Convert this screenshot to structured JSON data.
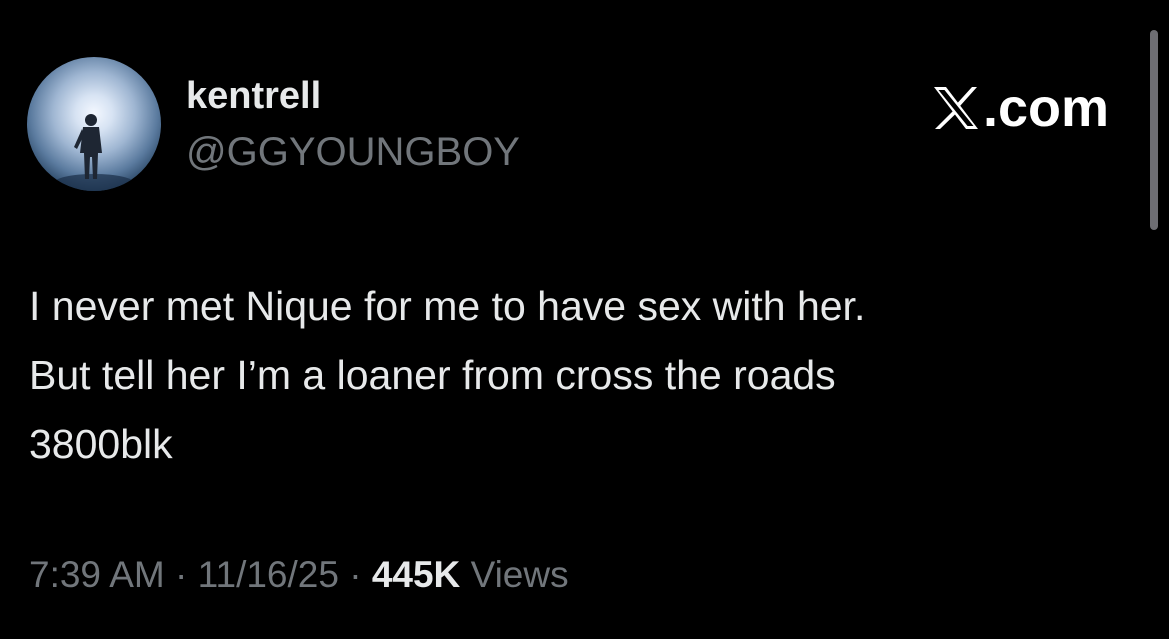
{
  "tweet": {
    "author": {
      "display_name": "kentrell",
      "handle": "@GGYOUNGBOY",
      "avatar_icon": "profile-photo-silhouette-in-light"
    },
    "brand": {
      "label": ".com",
      "icon": "x-logo-icon"
    },
    "text_lines": [
      "I never met Nique for me to have sex with her.",
      "But tell her I’m a loaner from cross the roads",
      "3800blk"
    ],
    "time": "7:39 AM",
    "separator": "·",
    "date": "11/16/25",
    "views_count": "445K",
    "views_label": "Views"
  },
  "colors": {
    "background": "#000000",
    "primary_text": "#e7e9ea",
    "secondary_text": "#71767b",
    "scrollbar": "#6e6e73"
  }
}
